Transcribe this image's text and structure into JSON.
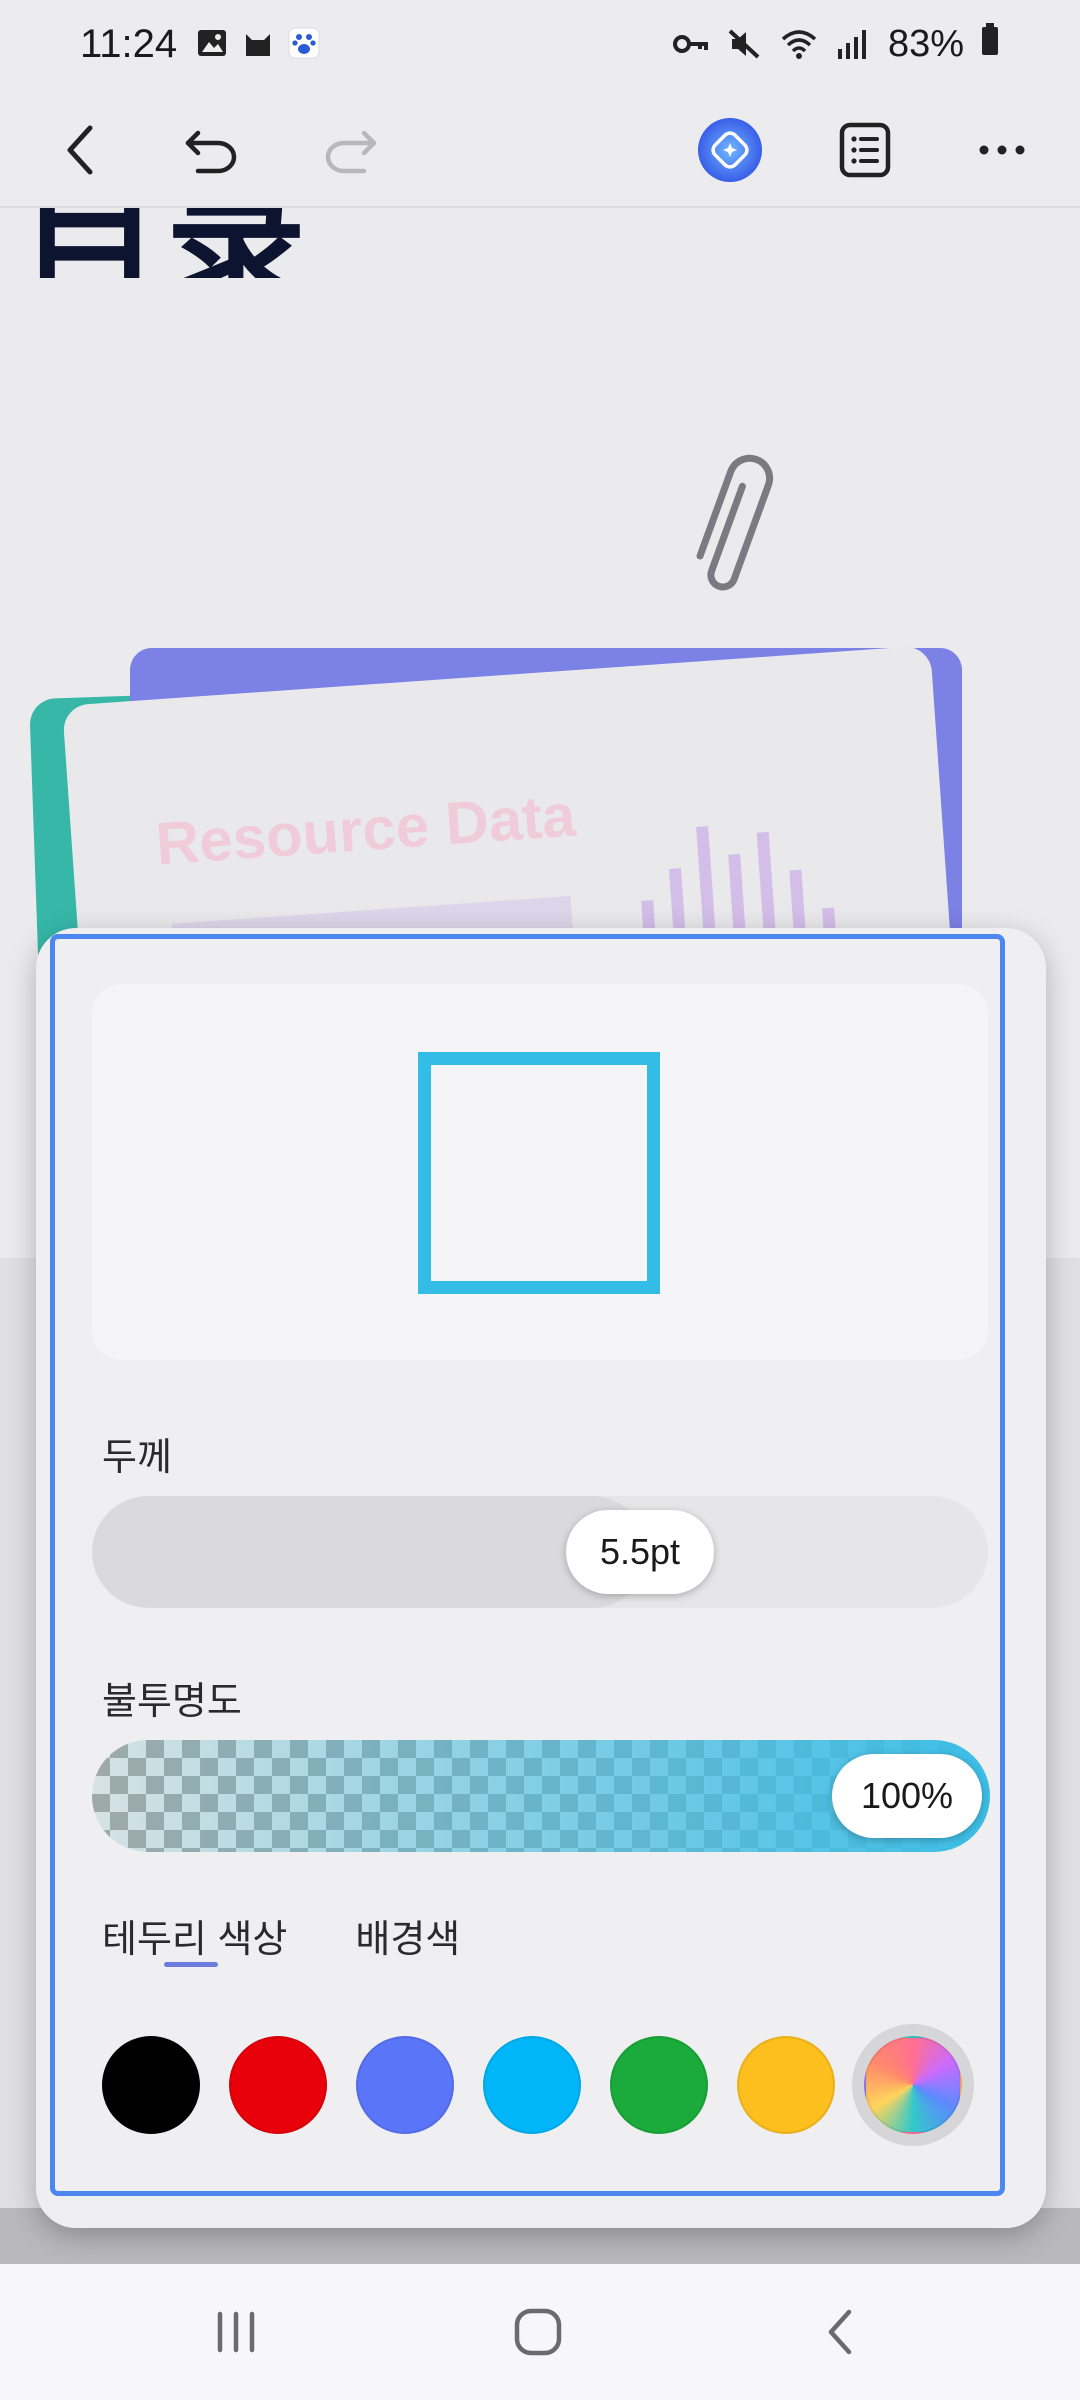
{
  "status_bar": {
    "time": "11:24",
    "battery": "83%",
    "left_icons": [
      "gallery-icon",
      "cat-icon",
      "baidu-icon"
    ],
    "right_icons": [
      "vpn-key-icon",
      "mute-icon",
      "wifi-icon",
      "signal-icon",
      "battery-icon"
    ]
  },
  "toolbar": {
    "icons": [
      "back-icon",
      "undo-icon",
      "redo-icon",
      "ai-assistant-icon",
      "outline-icon",
      "more-icon"
    ]
  },
  "document": {
    "title_fragment": "目录",
    "card_heading": "Resource Data"
  },
  "shape_panel": {
    "thickness_label": "두께",
    "thickness_value": "5.5pt",
    "thickness_fraction": 0.62,
    "opacity_label": "불투명도",
    "opacity_value": "100%",
    "opacity_fraction": 1.0,
    "tabs": [
      {
        "label": "테두리 색상",
        "selected": true
      },
      {
        "label": "배경색",
        "selected": false
      }
    ],
    "preview_stroke_color": "#33bde6",
    "swatches": [
      {
        "name": "black",
        "color": "#000000"
      },
      {
        "name": "red",
        "color": "#e8000b"
      },
      {
        "name": "blue",
        "color": "#5b75f8"
      },
      {
        "name": "sky-blue",
        "color": "#00b6f9"
      },
      {
        "name": "green",
        "color": "#1bab3c"
      },
      {
        "name": "yellow",
        "color": "#fcbf1e"
      },
      {
        "name": "custom-rainbow",
        "color": "rainbow"
      }
    ]
  },
  "nav_bar": {
    "icons": [
      "recents-icon",
      "home-icon",
      "back-nav-icon"
    ]
  }
}
